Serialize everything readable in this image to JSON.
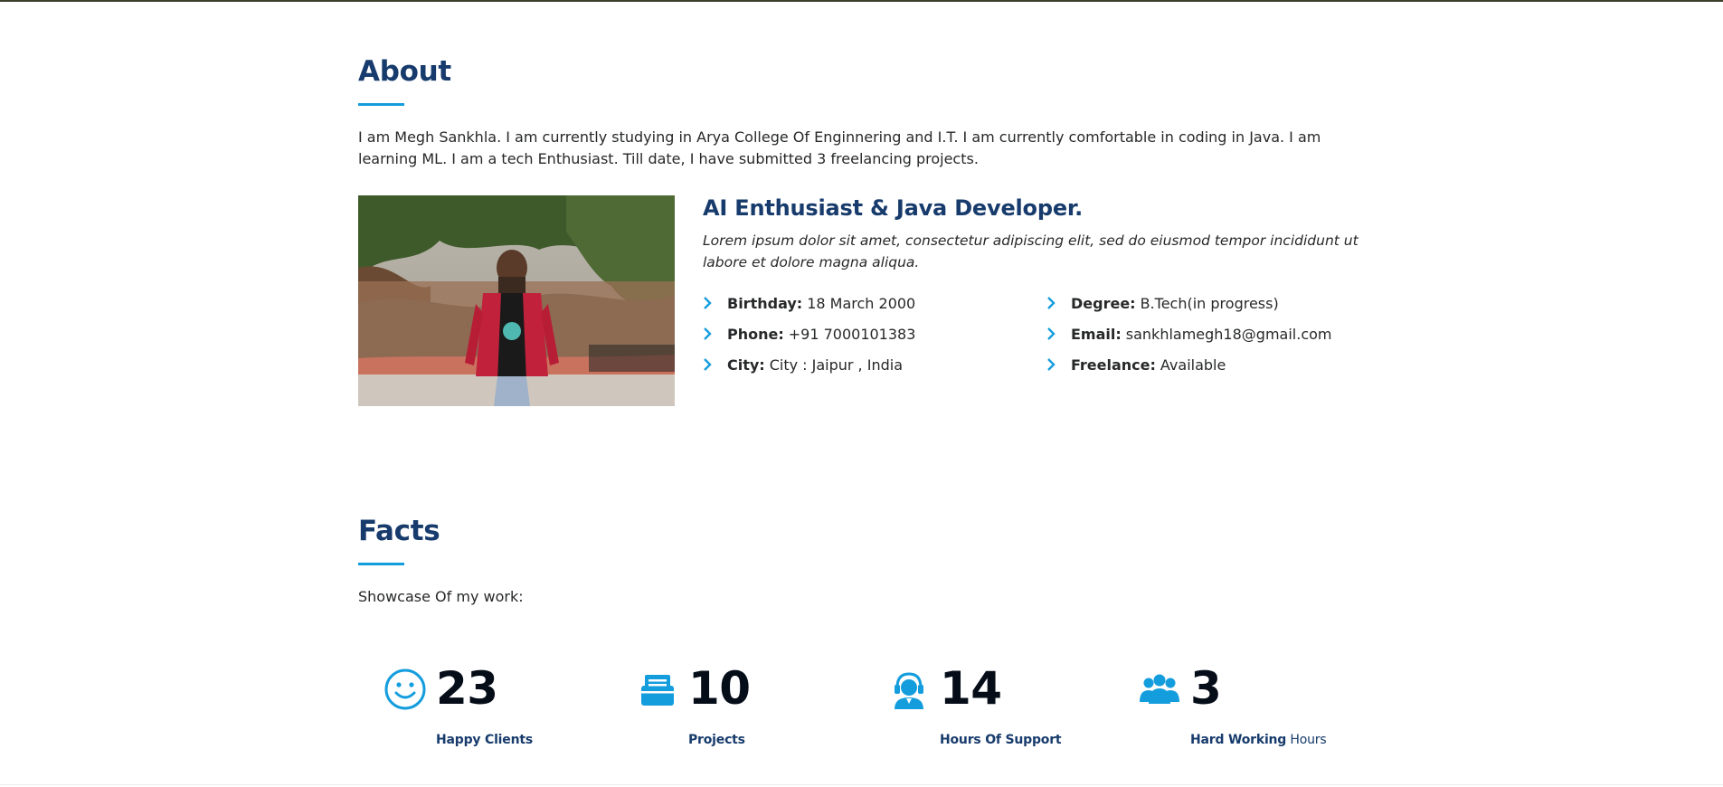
{
  "about": {
    "title": "About",
    "description": "I am Megh Sankhla. I am currently studying in Arya College Of Enginnering and I.T. I am currently comfortable in coding in Java. I am learning ML. I am a tech Enthusiast. Till date, I have submitted 3 freelancing projects.",
    "headline": "AI Enthusiast & Java Developer.",
    "lead": "Lorem ipsum dolor sit amet, consectetur adipiscing elit, sed do eiusmod tempor incididunt ut labore et dolore magna aliqua.",
    "info_left": [
      {
        "label": "Birthday:",
        "value": "18 March 2000"
      },
      {
        "label": "Phone:",
        "value": "+91 7000101383"
      },
      {
        "label": "City:",
        "value": "City : Jaipur , India"
      }
    ],
    "info_right": [
      {
        "label": "Degree:",
        "value": "B.Tech(in progress)"
      },
      {
        "label": "Email:",
        "value": "sankhlamegh18@gmail.com"
      },
      {
        "label": "Freelance:",
        "value": "Available"
      }
    ]
  },
  "facts": {
    "title": "Facts",
    "description": "Showcase Of my work:",
    "counts": [
      {
        "icon": "smile-icon",
        "number": "23",
        "label_strong": "Happy Clients",
        "label_light": ""
      },
      {
        "icon": "journal-icon",
        "number": "10",
        "label_strong": "Projects",
        "label_light": ""
      },
      {
        "icon": "headset-icon",
        "number": "14",
        "label_strong": "Hours Of Support",
        "label_light": ""
      },
      {
        "icon": "people-icon",
        "number": "3",
        "label_strong": "Hard Working",
        "label_light": "Hours"
      }
    ]
  },
  "colors": {
    "accent": "#149ddd",
    "heading": "#173b6c",
    "number": "#050d18",
    "text": "#272829"
  }
}
